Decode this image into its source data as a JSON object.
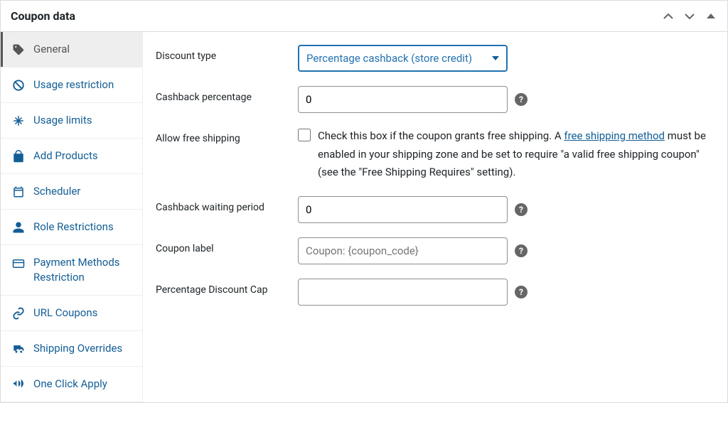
{
  "panel": {
    "title": "Coupon data"
  },
  "sidebar": {
    "items": [
      {
        "label": "General"
      },
      {
        "label": "Usage restriction"
      },
      {
        "label": "Usage limits"
      },
      {
        "label": "Add Products"
      },
      {
        "label": "Scheduler"
      },
      {
        "label": "Role Restrictions"
      },
      {
        "label": "Payment Methods Restriction"
      },
      {
        "label": "URL Coupons"
      },
      {
        "label": "Shipping Overrides"
      },
      {
        "label": "One Click Apply"
      }
    ]
  },
  "form": {
    "discount_type": {
      "label": "Discount type",
      "value": "Percentage cashback (store credit)"
    },
    "cashback_percentage": {
      "label": "Cashback percentage",
      "value": "0"
    },
    "allow_free_shipping": {
      "label": "Allow free shipping",
      "desc_pre": "Check this box if the coupon grants free shipping. A ",
      "link1": "free shipping method",
      "desc_post": " must be enabled in your shipping zone and be set to require \"a valid free shipping coupon\" (see the \"Free Shipping Requires\" setting)."
    },
    "cashback_waiting": {
      "label": "Cashback waiting period",
      "value": "0"
    },
    "coupon_label": {
      "label": "Coupon label",
      "placeholder": "Coupon: {coupon_code}"
    },
    "discount_cap": {
      "label": "Percentage Discount Cap",
      "value": ""
    }
  }
}
